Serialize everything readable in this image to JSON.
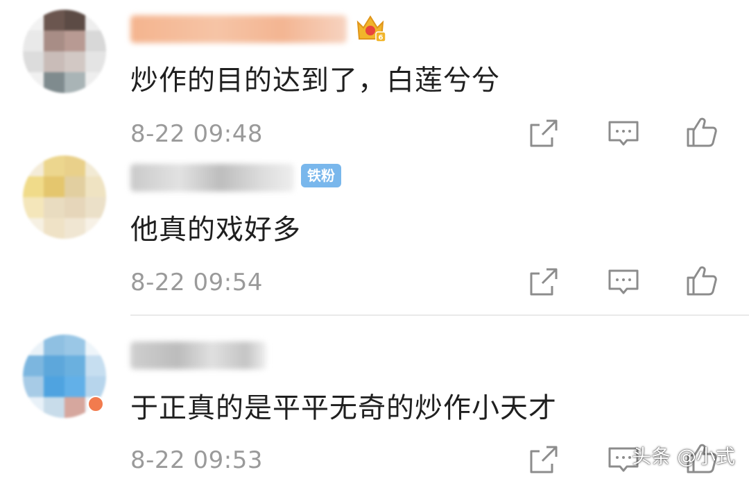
{
  "colors": {
    "text": "#1f1f1f",
    "meta": "#9a9a9a",
    "icon": "#8c8c8c",
    "fans_badge": "#79b7ec",
    "crown": "#f1b52a"
  },
  "comments": [
    {
      "username": "",
      "badge": "crown-badge-icon",
      "text": "炒作的目的达到了，白莲兮兮",
      "time": "8-22 09:48"
    },
    {
      "username": "",
      "badge_label": "铁粉",
      "text": "他真的戏好多",
      "time": "8-22 09:54"
    },
    {
      "username": "",
      "text": "于正真的是平平无奇的炒作小天才",
      "time": "8-22 09:53"
    }
  ],
  "actions": [
    "share-icon",
    "comment-icon",
    "like-icon"
  ],
  "watermark": "头条 @小式"
}
